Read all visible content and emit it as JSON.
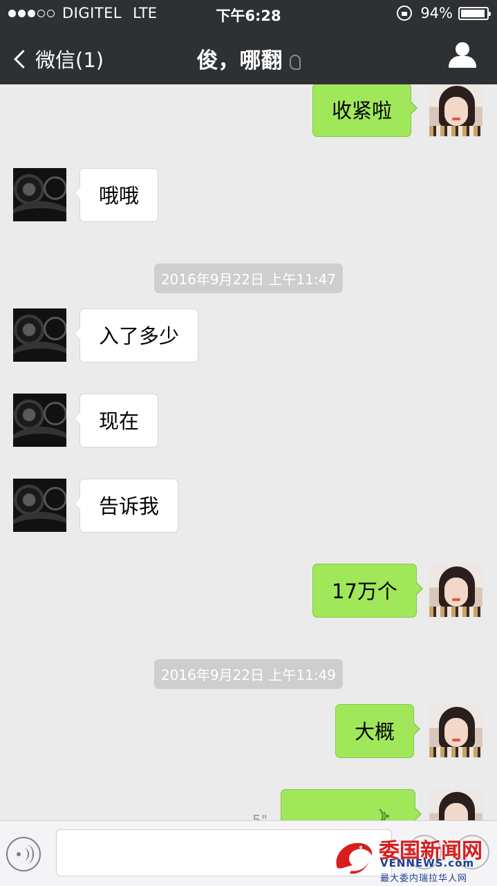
{
  "status_bar": {
    "carrier": "DIGITEL",
    "network": "LTE",
    "signal_dots": {
      "filled": 3,
      "total": 5
    },
    "time": "下午6:28",
    "battery_percent": "94%",
    "battery_level": 0.94
  },
  "nav": {
    "back_label": "微信(1)",
    "title": "俊，哪翻",
    "icons": [
      "chevron-left-icon",
      "ear-icon",
      "person-icon"
    ]
  },
  "messages": [
    {
      "side": "out",
      "text": "收紧啦"
    },
    {
      "side": "in",
      "text": "哦哦"
    },
    {
      "timestamp": "2016年9月22日 上午11:47"
    },
    {
      "side": "in",
      "text": "入了多少"
    },
    {
      "side": "in",
      "text": "现在"
    },
    {
      "side": "in",
      "text": "告诉我"
    },
    {
      "side": "out",
      "text": "17万个"
    },
    {
      "timestamp": "2016年9月22日 上午11:49"
    },
    {
      "side": "out",
      "text": "大概"
    },
    {
      "side": "out",
      "type": "voice",
      "duration": "5\""
    }
  ],
  "input_bar": {
    "icons": [
      "voice-icon",
      "emoji-icon",
      "plus-icon"
    ],
    "text_value": ""
  },
  "watermark": {
    "title_red": "委国",
    "title_blue": "新闻网",
    "domain": "VENNEWS.com",
    "tagline": "最大委内瑞拉华人网"
  },
  "colors": {
    "nav_bg": "#2e3134",
    "chat_bg": "#ebebeb",
    "outgoing_bubble": "#a0e75a",
    "incoming_bubble": "#ffffff",
    "timestamp_bg": "#cecece"
  }
}
